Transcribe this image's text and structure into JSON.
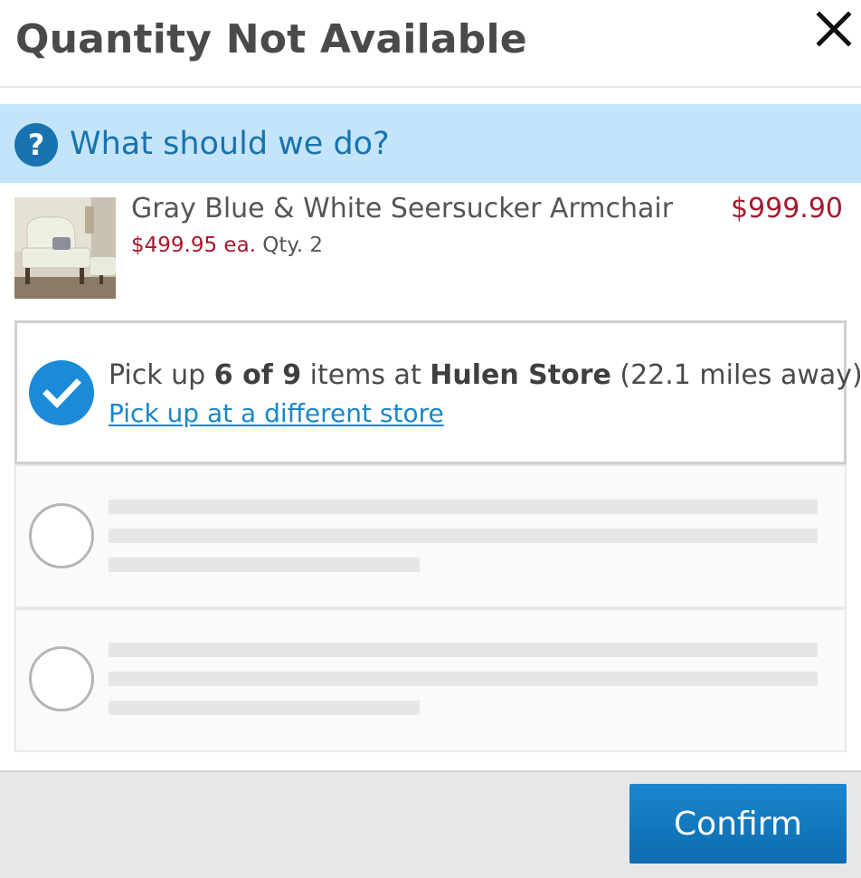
{
  "dialog": {
    "title": "Quantity Not Available",
    "close_icon": "close-icon"
  },
  "banner": {
    "text": "What should we do?",
    "icon": "question-circle-icon",
    "background_color": "#c4e5f9",
    "text_color": "#1873ae"
  },
  "product": {
    "name": "Gray Blue & White Seersucker Armchair",
    "total_price": "$999.90",
    "unit_price": "$499.95 ea.",
    "quantity": "Qty. 2",
    "price_color": "#a6192e",
    "image": "armchair-thumbnail"
  },
  "options": [
    {
      "selected": true,
      "text_prefix": "Pick up ",
      "count": "6 of 9",
      "text_middle": " items at ",
      "store": "Hulen Store",
      "distance": " (22.1 miles away).",
      "link": "Pick up at a different store"
    },
    {
      "selected": false,
      "loading": true
    },
    {
      "selected": false,
      "loading": true
    }
  ],
  "footer": {
    "confirm_label": "Confirm",
    "button_color": "#1479bf"
  }
}
